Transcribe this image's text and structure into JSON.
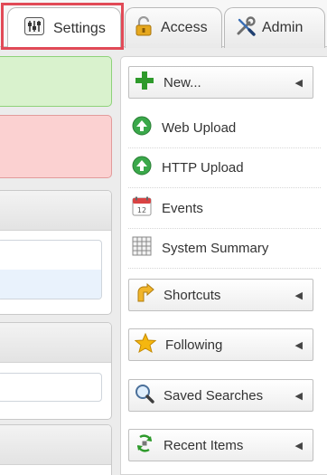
{
  "tabs": {
    "settings": {
      "label": "Settings",
      "icon": "settings-sliders-icon"
    },
    "access": {
      "label": "Access",
      "icon": "padlock-icon"
    },
    "admin": {
      "label": "Admin",
      "icon": "wrench-screwdriver-icon"
    }
  },
  "menu": {
    "new": {
      "label": "New...",
      "icon": "green-plus-icon"
    },
    "web_upload": {
      "label": "Web Upload",
      "icon": "upload-arrow-icon"
    },
    "http_upload": {
      "label": "HTTP Upload",
      "icon": "upload-arrow-icon"
    },
    "events": {
      "label": "Events",
      "icon": "calendar-icon"
    },
    "system_summary": {
      "label": "System Summary",
      "icon": "grid-table-icon"
    },
    "shortcuts": {
      "label": "Shortcuts",
      "icon": "shortcut-arrow-icon"
    },
    "following": {
      "label": "Following",
      "icon": "star-icon"
    },
    "saved_searches": {
      "label": "Saved Searches",
      "icon": "magnifier-icon"
    },
    "recent_items": {
      "label": "Recent Items",
      "icon": "recent-recycle-icon"
    }
  },
  "colors": {
    "highlight": "#e14a57",
    "success_bg": "#d9f2cd",
    "error_bg": "#fbd1d1",
    "plus_green": "#2e9a2b",
    "upload_green": "#3aa84a"
  }
}
